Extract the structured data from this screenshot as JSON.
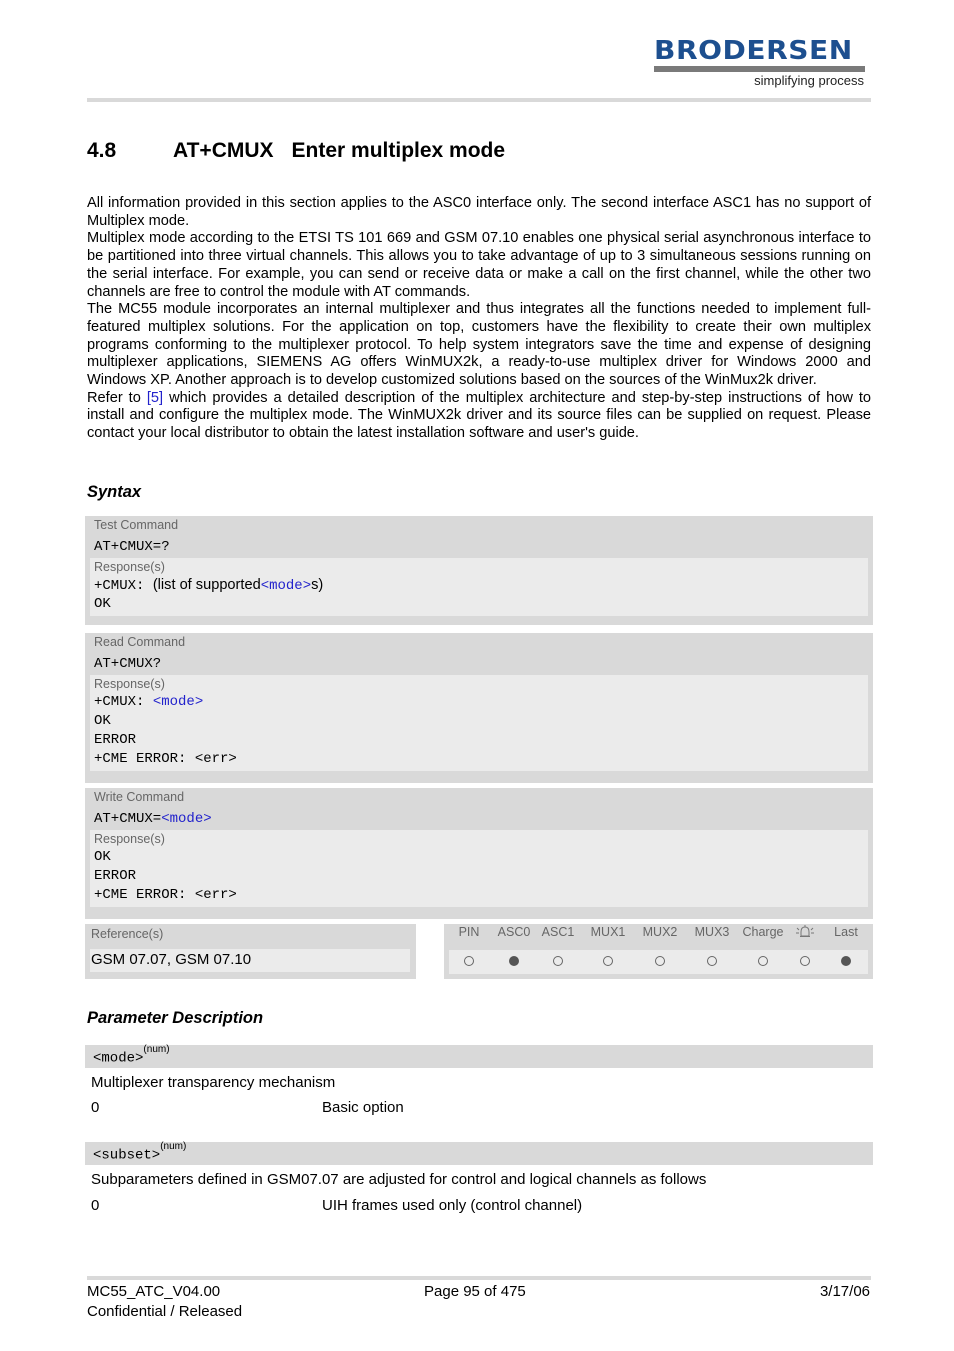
{
  "header": {
    "logo_text": "BRODERSEN",
    "logo_tagline": "simplifying process",
    "brand_color": "#1d4f8f"
  },
  "section": {
    "number": "4.8",
    "command": "AT+CMUX",
    "title": "Enter multiplex mode"
  },
  "intro": {
    "p1": "All information provided in this section applies to the ASC0 interface only. The second interface ASC1 has no support of Multiplex mode.",
    "p2": "Multiplex mode according to the ETSI TS 101 669 and GSM 07.10 enables one physical serial asynchronous interface to be partitioned into three virtual channels. This allows you to take advantage of up to 3 simultaneous sessions running on the serial interface. For example, you can send or receive data or make a call on the first channel, while the other two channels are free to control the module with AT commands.",
    "p3": "The MC55 module incorporates an internal multiplexer and thus integrates all the functions needed to implement full-featured multiplex solutions. For the application on top, customers have the flexibility to create their own multiplex programs conforming to the multiplexer protocol. To help system integrators save the time and expense of designing multiplexer applications, SIEMENS AG offers WinMUX2k, a ready-to-use multiplex driver for Windows 2000 and Windows XP. Another approach is to develop customized solutions based on the sources of the WinMux2k driver.",
    "p4_before": "Refer to ",
    "p4_link": "[5]",
    "p4_after": " which provides a detailed description of the multiplex architecture and step-by-step instructions of how to install and configure the multiplex mode. The WinMUX2k driver and its source files can be supplied on request. Please contact your local distributor to obtain the latest installation software and user's guide."
  },
  "syntax": {
    "heading": "Syntax",
    "response_label": "Response(s)",
    "test": {
      "label": "Test Command",
      "command": "AT+CMUX=?",
      "resp_prefix": "+CMUX: ",
      "resp_text_before": " (list of supported",
      "resp_param": "<mode>",
      "resp_text_after": "s)",
      "resp_ok": "OK"
    },
    "read": {
      "label": "Read Command",
      "command": "AT+CMUX?",
      "resp_prefix": "+CMUX: ",
      "resp_param": "<mode>",
      "lines": [
        "OK",
        "ERROR",
        "+CME ERROR: <err>"
      ]
    },
    "write": {
      "label": "Write Command",
      "command_prefix": "AT+CMUX=",
      "command_param": "<mode>",
      "lines": [
        "OK",
        "ERROR",
        "+CME ERROR: <err>"
      ]
    },
    "reference": {
      "label": "Reference(s)",
      "value": "GSM 07.07, GSM 07.10"
    },
    "availability": {
      "columns": [
        "PIN",
        "ASC0",
        "ASC1",
        "MUX1",
        "MUX2",
        "MUX3",
        "Charge",
        "alarm-icon",
        "Last"
      ],
      "values": [
        false,
        true,
        false,
        false,
        false,
        false,
        false,
        false,
        true
      ]
    }
  },
  "params": {
    "heading": "Parameter Description",
    "items": [
      {
        "name": "<mode>",
        "type": "(num)",
        "description": "Multiplexer transparency mechanism",
        "values": [
          {
            "value": "0",
            "desc": "Basic option"
          }
        ]
      },
      {
        "name": "<subset>",
        "type": "(num)",
        "description": "Subparameters defined in GSM07.07 are adjusted for control and logical channels as follows",
        "values": [
          {
            "value": "0",
            "desc": "UIH frames used only (control channel)"
          }
        ]
      }
    ]
  },
  "footer": {
    "doc_id": "MC55_ATC_V04.00",
    "status": "Confidential / Released",
    "page": "Page 95 of 475",
    "date": "3/17/06"
  }
}
